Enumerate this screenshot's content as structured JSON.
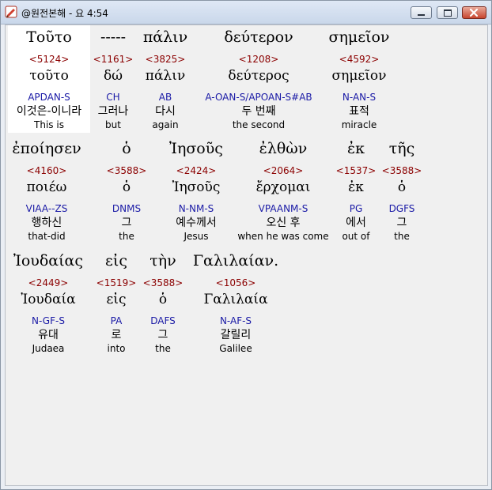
{
  "window": {
    "title": "@원전본해 - 요 4:54",
    "minimize_icon": "minimize-icon",
    "maximize_icon": "maximize-icon",
    "close_icon": "close-icon"
  },
  "rows": [
    {
      "words": [
        {
          "greek": "Τοῦτο",
          "number": "<5124>",
          "lemma": "τοῦτο",
          "parse": "APDAN-S",
          "korean": "이것은-이니라",
          "english": "This is",
          "selected": true
        },
        {
          "greek": "-----",
          "number": "<1161>",
          "lemma": "δώ",
          "parse": "CH",
          "korean": "그러나",
          "english": "but"
        },
        {
          "greek": "πάλιν",
          "number": "<3825>",
          "lemma": "πάλιν",
          "parse": "AB",
          "korean": "다시",
          "english": "again"
        },
        {
          "greek": "δεύτερον",
          "number": "<1208>",
          "lemma": "δεύτερος",
          "parse": "A-OAN-S/APOAN-S#AB",
          "korean": "두 번째",
          "english": "the second"
        },
        {
          "greek": "σημεῖον",
          "number": "<4592>",
          "lemma": "σημεῖον",
          "parse": "N-AN-S",
          "korean": "표적",
          "english": "miracle"
        }
      ]
    },
    {
      "words": [
        {
          "greek": "ἐποίησεν",
          "number": "<4160>",
          "lemma": "ποιέω",
          "parse": "VIAA--ZS",
          "korean": "행하신",
          "english": "that-did"
        },
        {
          "greek": "ὁ",
          "number": "<3588>",
          "lemma": "ὁ",
          "parse": "DNMS",
          "korean": "그",
          "english": "the"
        },
        {
          "greek": "Ἰησοῦς",
          "number": "<2424>",
          "lemma": "Ἰησοῦς",
          "parse": "N-NM-S",
          "korean": "예수께서",
          "english": "Jesus"
        },
        {
          "greek": "ἐλθὼν",
          "number": "<2064>",
          "lemma": "ἔρχομαι",
          "parse": "VPAANM-S",
          "korean": "오신 후",
          "english": "when he was come"
        },
        {
          "greek": "ἐκ",
          "number": "<1537>",
          "lemma": "ἐκ",
          "parse": "PG",
          "korean": "에서",
          "english": "out of"
        },
        {
          "greek": "τῆς",
          "number": "<3588>",
          "lemma": "ὁ",
          "parse": "DGFS",
          "korean": "그",
          "english": "the"
        }
      ]
    },
    {
      "words": [
        {
          "greek": "Ἰουδαίας",
          "number": "<2449>",
          "lemma": "Ἰουδαία",
          "parse": "N-GF-S",
          "korean": "유대",
          "english": "Judaea"
        },
        {
          "greek": "εἰς",
          "number": "<1519>",
          "lemma": "εἰς",
          "parse": "PA",
          "korean": "로",
          "english": "into"
        },
        {
          "greek": "τὴν",
          "number": "<3588>",
          "lemma": "ὁ",
          "parse": "DAFS",
          "korean": "그",
          "english": "the"
        },
        {
          "greek": "Γαλιλαίαν.",
          "number": "<1056>",
          "lemma": "Γαλιλαία",
          "parse": "N-AF-S",
          "korean": "갈릴리",
          "english": "Galilee"
        }
      ]
    }
  ]
}
